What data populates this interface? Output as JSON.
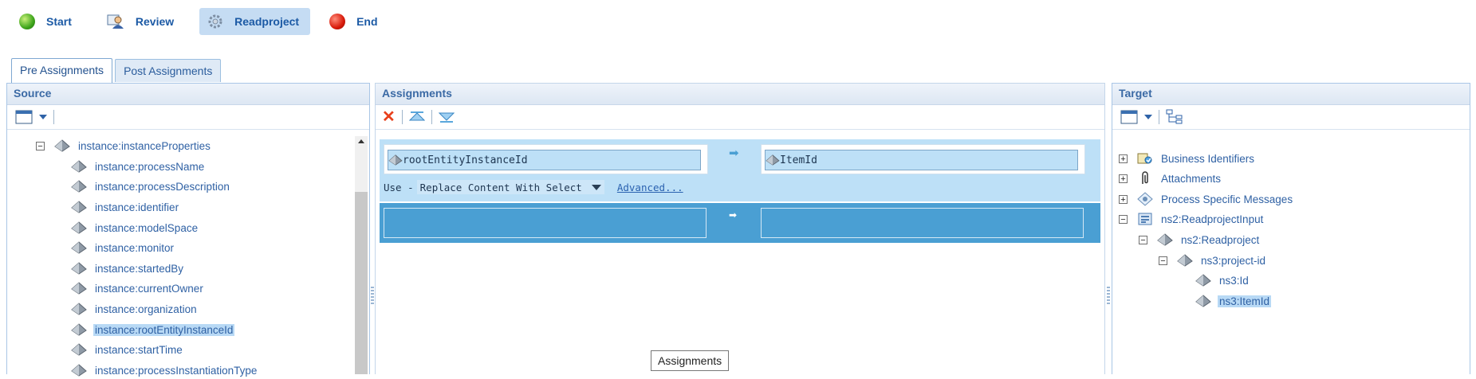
{
  "workflow": [
    {
      "label": "Start",
      "icon": "green-circle-icon"
    },
    {
      "label": "Review",
      "icon": "user-review-icon"
    },
    {
      "label": "Readproject",
      "icon": "gear-icon"
    },
    {
      "label": "End",
      "icon": "red-circle-icon"
    }
  ],
  "tabs": [
    "Pre Assignments",
    "Post Assignments"
  ],
  "source": {
    "title": "Source",
    "tree": [
      {
        "label": "instance:instanceProperties",
        "expander": "−"
      },
      {
        "label": "instance:processName"
      },
      {
        "label": "instance:processDescription"
      },
      {
        "label": "instance:identifier"
      },
      {
        "label": "instance:modelSpace"
      },
      {
        "label": "instance:monitor"
      },
      {
        "label": "instance:startedBy"
      },
      {
        "label": "instance:currentOwner"
      },
      {
        "label": "instance:organization"
      },
      {
        "label": "instance:rootEntityInstanceId",
        "selected": true
      },
      {
        "label": "instance:startTime"
      },
      {
        "label": "instance:processInstantiationType"
      }
    ]
  },
  "assignments": {
    "title": "Assignments",
    "from_field": "rootEntityInstanceId",
    "to_field": "ItemId",
    "use_label": "Use -",
    "use_select": "Replace Content With Select",
    "advanced_link": "Advanced..."
  },
  "target": {
    "title": "Target",
    "tree": [
      {
        "label": "Business Identifiers",
        "expander": "+"
      },
      {
        "label": "Attachments",
        "expander": "+"
      },
      {
        "label": "Process Specific Messages",
        "expander": "+"
      },
      {
        "label": "ns2:ReadprojectInput",
        "expander": "−"
      },
      {
        "label": "ns2:Readproject",
        "expander": "−"
      },
      {
        "label": "ns3:project-id",
        "expander": "−"
      },
      {
        "label": "ns3:Id"
      },
      {
        "label": "ns3:ItemId",
        "selected": true
      }
    ]
  },
  "tooltip": "Assignments",
  "colors": {
    "accent": "#1c5aa5",
    "row_highlight": "#bde0f7",
    "row_blue": "#4a9fd3",
    "delete_red": "#e8401c"
  }
}
